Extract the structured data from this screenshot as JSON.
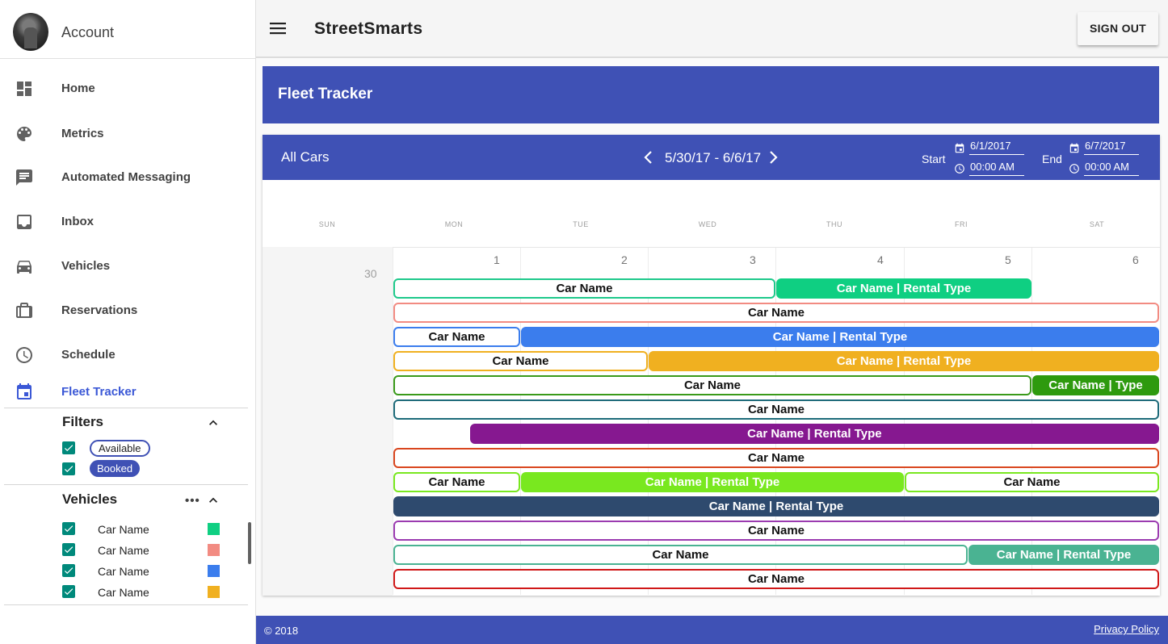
{
  "sidebar": {
    "account_label": "Account",
    "nav": [
      {
        "label": "Home",
        "icon": "dashboard-icon"
      },
      {
        "label": "Metrics",
        "icon": "palette-icon"
      },
      {
        "label": "Automated Messaging",
        "icon": "message-icon"
      },
      {
        "label": "Inbox",
        "icon": "inbox-icon"
      },
      {
        "label": "Vehicles",
        "icon": "car-icon"
      },
      {
        "label": "Reservations",
        "icon": "briefcase-icon"
      },
      {
        "label": "Schedule",
        "icon": "clock-icon"
      },
      {
        "label": "Fleet Tracker",
        "icon": "calendar-icon",
        "active": true
      }
    ],
    "filters": {
      "title": "Filters",
      "items": [
        {
          "label": "Available",
          "checked": true
        },
        {
          "label": "Booked",
          "checked": true
        }
      ]
    },
    "vehicles": {
      "title": "Vehicles",
      "more": "•••",
      "items": [
        {
          "label": "Car Name",
          "color": "#0fcf82",
          "checked": true
        },
        {
          "label": "Car Name",
          "color": "#f28b82",
          "checked": true
        },
        {
          "label": "Car Name",
          "color": "#3b7ded",
          "checked": true
        },
        {
          "label": "Car Name",
          "color": "#f0b020",
          "checked": true
        }
      ]
    }
  },
  "topbar": {
    "app_title": "StreetSmarts",
    "signout_label": "SIGN OUT"
  },
  "page": {
    "title": "Fleet Tracker"
  },
  "calendar": {
    "scope": "All Cars",
    "range": "5/30/17 - 6/6/17",
    "start_label": "Start",
    "start_date": "6/1/2017",
    "start_time": "00:00 AM",
    "end_label": "End",
    "end_date": "6/7/2017",
    "end_time": "00:00 AM",
    "days_of_week": [
      "SUN",
      "MON",
      "TUE",
      "WED",
      "THU",
      "FRI",
      "SAT"
    ],
    "first_day": "30",
    "day_numbers": [
      "1",
      "2",
      "3",
      "4",
      "5",
      "6"
    ],
    "events": [
      {
        "label": "Car Name",
        "color": "#1ec98b",
        "filled": false,
        "start": 0.0,
        "end": 3.0
      },
      {
        "label": "Car Name | Rental Type",
        "color": "#0fcf82",
        "filled": true,
        "start": 3.0,
        "end": 5.0
      },
      {
        "label": "Car Name",
        "color": "#f28b82",
        "filled": false,
        "start": 0.0,
        "end": 6.0
      },
      {
        "label": "Car Name",
        "color": "#3b7ded",
        "filled": false,
        "start": 0.0,
        "end": 1.0
      },
      {
        "label": "Car Name | Rental Type",
        "color": "#3b7ded",
        "filled": true,
        "start": 1.0,
        "end": 6.0
      },
      {
        "label": "Car Name",
        "color": "#f0b020",
        "filled": false,
        "start": 0.0,
        "end": 2.0
      },
      {
        "label": "Car Name | Rental Type",
        "color": "#f0b020",
        "filled": true,
        "start": 2.0,
        "end": 6.0
      },
      {
        "label": "Car Name",
        "color": "#3a9a1a",
        "filled": false,
        "start": 0.0,
        "end": 5.0
      },
      {
        "label": "Car Name | Type",
        "color": "#2e9a0e",
        "filled": true,
        "start": 5.0,
        "end": 6.0
      },
      {
        "label": "Car Name",
        "color": "#1e6b7a",
        "filled": false,
        "start": 0.0,
        "end": 6.0
      },
      {
        "label": "Car Name | Rental Type",
        "color": "#861890",
        "filled": true,
        "start": 0.6,
        "end": 6.0
      },
      {
        "label": "Car Name",
        "color": "#d9461e",
        "filled": false,
        "start": 0.0,
        "end": 6.0
      },
      {
        "label": "Car Name",
        "color": "#79e81f",
        "filled": false,
        "start": 0.0,
        "end": 1.0
      },
      {
        "label": "Car Name | Rental Type",
        "color": "#79e81f",
        "filled": true,
        "start": 1.0,
        "end": 4.0
      },
      {
        "label": "Car Name",
        "color": "#79e81f",
        "filled": false,
        "start": 4.0,
        "end": 6.0
      },
      {
        "label": "Car Name | Rental Type",
        "color": "#2e4a6e",
        "filled": true,
        "start": 0.0,
        "end": 6.0
      },
      {
        "label": "Car Name",
        "color": "#9b3bb0",
        "filled": false,
        "start": 0.0,
        "end": 6.0
      },
      {
        "label": "Car Name",
        "color": "#4ab392",
        "filled": false,
        "start": 0.0,
        "end": 4.5
      },
      {
        "label": "Car Name | Rental Type",
        "color": "#4ab392",
        "filled": true,
        "start": 4.5,
        "end": 6.0
      },
      {
        "label": "Car Name",
        "color": "#d01818",
        "filled": false,
        "start": 0.0,
        "end": 6.0
      }
    ]
  },
  "footer": {
    "copyright": "© 2018",
    "privacy": "Privacy Policy"
  }
}
